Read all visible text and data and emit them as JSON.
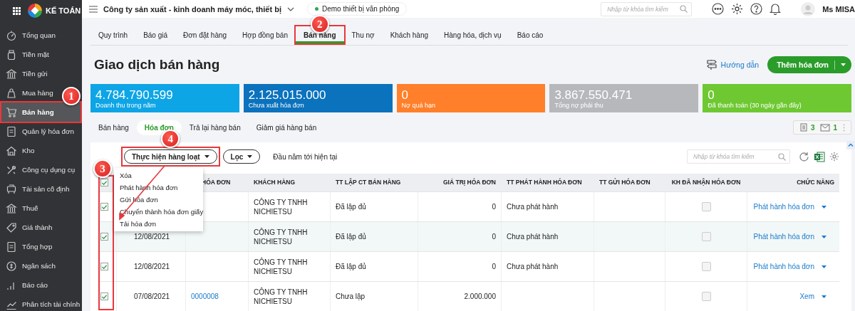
{
  "app": {
    "logo_text": "KẾ TOÁN"
  },
  "sidebar": {
    "items": [
      {
        "label": "Tổng quan",
        "selected": false
      },
      {
        "label": "Tiền mặt",
        "selected": false
      },
      {
        "label": "Tiền gửi",
        "selected": false
      },
      {
        "label": "Mua hàng",
        "selected": false
      },
      {
        "label": "Bán hàng",
        "selected": true,
        "highlighted": true,
        "callout": "1"
      },
      {
        "label": "Quản lý hóa đơn",
        "selected": false
      },
      {
        "label": "Kho",
        "selected": false
      },
      {
        "label": "Công cụ dụng cụ",
        "selected": false
      },
      {
        "label": "Tài sản cố định",
        "selected": false
      },
      {
        "label": "Thuế",
        "selected": false
      },
      {
        "label": "Giá thành",
        "selected": false
      },
      {
        "label": "Tổng hợp",
        "selected": false
      },
      {
        "label": "Ngân sách",
        "selected": false
      },
      {
        "label": "Báo cáo",
        "selected": false
      },
      {
        "label": "Phân tích tài chính",
        "selected": false
      }
    ]
  },
  "topbar": {
    "company": "Công ty sản xuất - kinh doanh máy móc, thiết bị",
    "database": "Demo thiết bị văn phòng",
    "search_placeholder": "Nhập từ khóa tìm kiếm",
    "user": "Ms MISA"
  },
  "nav_tabs": [
    {
      "label": "Quy trình",
      "selected": false
    },
    {
      "label": "Báo giá",
      "selected": false
    },
    {
      "label": "Đơn đặt hàng",
      "selected": false
    },
    {
      "label": "Hợp đồng bán",
      "selected": false
    },
    {
      "label": "Bán hàng",
      "selected": true,
      "highlighted": true,
      "callout": "2"
    },
    {
      "label": "Thu nợ",
      "selected": false
    },
    {
      "label": "Khách hàng",
      "selected": false
    },
    {
      "label": "Hàng hóa, dịch vụ",
      "selected": false
    },
    {
      "label": "Báo cáo",
      "selected": false
    }
  ],
  "page": {
    "title": "Giao dịch bán hàng",
    "guide_link": "Hướng dẫn",
    "add_button": "Thêm hóa đơn"
  },
  "summary_cards": [
    {
      "value": "4.784.790.599",
      "label": "Doanh thu trong năm",
      "color": "#0ea5e6"
    },
    {
      "value": "2.125.015.000",
      "label": "Chưa xuất hóa đơn",
      "color": "#0b72bd"
    },
    {
      "value": "0",
      "label": "Nợ quá hạn",
      "color": "#ff7f2a"
    },
    {
      "value": "3.867.550.471",
      "label": "Tổng nợ phải thu",
      "color": "#b6b8bc"
    },
    {
      "value": "0",
      "label": "Đã thanh toán (30 ngày gần đây)",
      "color": "#6ec832"
    }
  ],
  "sub_tabs": [
    {
      "label": "Bán hàng",
      "selected": false
    },
    {
      "label": "Hóa đơn",
      "selected": true
    },
    {
      "label": "Trả lại hàng bán",
      "selected": false
    },
    {
      "label": "Giảm giá hàng bán",
      "selected": false
    }
  ],
  "counters": [
    {
      "kind": "document",
      "count": "3"
    },
    {
      "kind": "mail",
      "count": "1"
    }
  ],
  "toolbar": {
    "bulk_button": {
      "label": "Thực hiện hàng loạt",
      "highlighted": true,
      "callout": "4"
    },
    "filter_button": "Lọc",
    "period": "Đầu năm tới hiện tại",
    "search_placeholder": "Nhập từ khóa tìm kiếm"
  },
  "bulk_menu": {
    "items": [
      {
        "label": "Xóa",
        "pointed": false
      },
      {
        "label": "Phát hành hóa đơn",
        "pointed": false
      },
      {
        "label": "Gửi hóa đơn",
        "pointed": false
      },
      {
        "label": "Chuyển thành hóa đơn giấy",
        "pointed": false
      },
      {
        "label": "Tải hóa đơn",
        "pointed": true
      }
    ]
  },
  "table": {
    "select_all_checked": true,
    "checkbox_column": {
      "highlighted": true,
      "callout": "3"
    },
    "columns": [
      "HÓA ĐƠN",
      "KHÁCH HÀNG",
      "TT LẬP CT BÁN HÀNG",
      "GIÁ TRỊ HÓA ĐƠN",
      "TT PHÁT HÀNH HÓA ĐƠN",
      "TT GỬI HÓA ĐƠN",
      "KH ĐÃ NHẬN HÓA ĐƠN",
      "CHỨC NĂNG"
    ],
    "rows": [
      {
        "checked": true,
        "hovered": false,
        "customer": "CÔNG TY TNHH NICHIETSU",
        "entry_status": "Đã lập đủ",
        "value": "0",
        "issue_status": "Chưa phát hành",
        "received": false,
        "action": "Phát hành hóa đơn"
      },
      {
        "checked": true,
        "hovered": true,
        "date": "12/08/2021",
        "customer": "CÔNG TY TNHH NICHIETSU",
        "entry_status": "Đã lập đủ",
        "value": "0",
        "issue_status": "Chưa phát hành",
        "received": false,
        "action": "Phát hành hóa đơn"
      },
      {
        "checked": true,
        "hovered": false,
        "date": "12/08/2021",
        "customer": "CÔNG TY TNHH NICHIETSU",
        "entry_status": "Đã lập đủ",
        "value": "0",
        "issue_status": "Chưa phát hành",
        "received": false,
        "action": "Phát hành hóa đơn"
      },
      {
        "checked": true,
        "hovered": false,
        "date": "07/08/2021",
        "number": "0000008",
        "customer": "CÔNG TY TNHH NICHIETSU",
        "entry_status": "Chưa lập",
        "value": "2.000.000",
        "received": false,
        "action": "Xem"
      }
    ]
  }
}
